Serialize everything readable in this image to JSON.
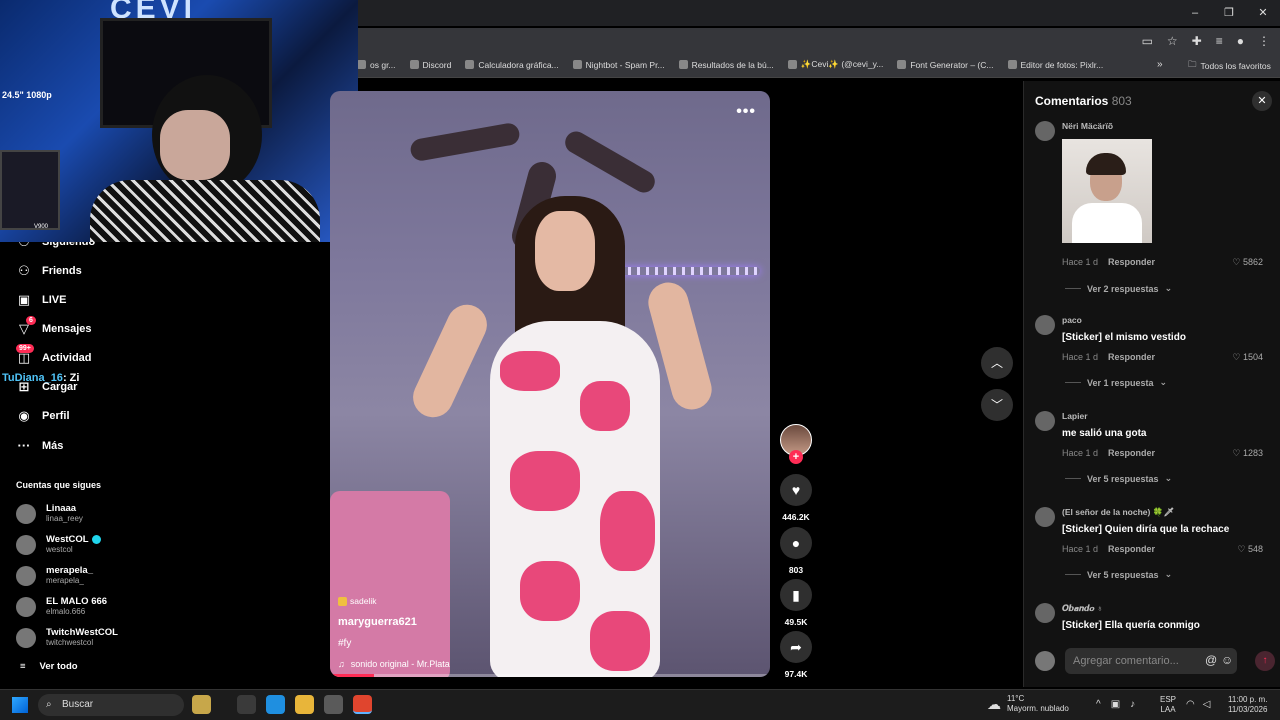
{
  "window": {
    "minimize": "–",
    "maximize": "❐",
    "close": "✕"
  },
  "bookmarks": {
    "items": [
      {
        "label": "os gr...",
        "icon": "page-icon"
      },
      {
        "label": "Discord",
        "icon": "discord-icon"
      },
      {
        "label": "Calculadora gráfica...",
        "icon": "desmos-icon"
      },
      {
        "label": "Nightbot - Spam Pr...",
        "icon": "nightbot-icon"
      },
      {
        "label": "Resultados de la bú...",
        "icon": "doc-icon"
      },
      {
        "label": "✨Cevi✨ (@cevi_y...",
        "icon": "tiktok-icon"
      },
      {
        "label": "Font Generator – (C...",
        "icon": "font-icon"
      },
      {
        "label": "Editor de fotos: Pixlr...",
        "icon": "pixlr-icon"
      }
    ],
    "more": "»",
    "all_favorites": "Todos los favoritos"
  },
  "webcam": {
    "overlay_text": "24.5\" 1080p",
    "logo": "CEVI",
    "pc_label": "V900"
  },
  "nav": {
    "items": [
      {
        "label": "Friends",
        "icon": "friends-icon"
      },
      {
        "label": "LIVE",
        "icon": "live-icon"
      },
      {
        "label": "Mensajes",
        "icon": "messages-icon",
        "badge": "6"
      },
      {
        "label": "Actividad",
        "icon": "activity-icon",
        "badge": "99+"
      },
      {
        "label": "Cargar",
        "icon": "upload-icon"
      },
      {
        "label": "Perfil",
        "icon": "profile-icon"
      },
      {
        "label": "Más",
        "icon": "more-icon"
      }
    ],
    "partial_item": "Siguiendo"
  },
  "chat_overlay": {
    "user": "TuDiana_16",
    "message": ": Zi"
  },
  "following": {
    "title": "Cuentas que sigues",
    "accounts": [
      {
        "name": "Linaaa",
        "handle": "linaa_reey",
        "verified": false
      },
      {
        "name": "WestCOL",
        "handle": "westcol",
        "verified": true
      },
      {
        "name": "merapela_",
        "handle": "merapela_",
        "verified": false
      },
      {
        "name": "EL MALO 666",
        "handle": "elmalo.666",
        "verified": false
      },
      {
        "name": "TwitchWestCOL",
        "handle": "twitchwestcol",
        "verified": false
      }
    ],
    "see_all": "Ver todo"
  },
  "video": {
    "menu": "•••",
    "effect": "sadelik",
    "author": "maryguerra621",
    "caption": "#fy",
    "sound": "sonido original - Mr.Plata",
    "progress": 0.1
  },
  "actions": {
    "follow": "+",
    "likes": "446.2K",
    "comments": "803",
    "saves": "49.5K",
    "shares": "97.4K"
  },
  "comments": {
    "title": "Comentarios",
    "count": "803",
    "list": [
      {
        "user": "Nëri Mäcärïõ",
        "text": "",
        "time": "Hace 1 d",
        "reply": "Responder",
        "likes": "5862",
        "replies": "Ver 2 respuestas",
        "has_image": true
      },
      {
        "user": "paco",
        "text": "[Sticker] el mismo vestido",
        "time": "Hace 1 d",
        "reply": "Responder",
        "likes": "1504",
        "replies": "Ver 1 respuesta",
        "has_image": false
      },
      {
        "user": "Lapier",
        "text": "me salió una gota",
        "time": "Hace 1 d",
        "reply": "Responder",
        "likes": "1283",
        "replies": "Ver 5 respuestas",
        "has_image": false
      },
      {
        "user": "(El señor de la noche) 🍀🗡",
        "text": "[Sticker] Quien diría que la rechace",
        "time": "Hace 1 d",
        "reply": "Responder",
        "likes": "548",
        "replies": "Ver 5 respuestas",
        "has_image": false
      },
      {
        "user": "𝑶𝒃𝒂𝒏𝒅𝒐 ♁",
        "text": "[Sticker] Ella quería conmigo",
        "time": "",
        "reply": "",
        "likes": "",
        "replies": "",
        "has_image": false
      }
    ],
    "input_placeholder": "Agregar comentario..."
  },
  "taskbar": {
    "search": "Buscar",
    "weather_temp": "11°C",
    "weather_desc": "Mayorm. nublado",
    "lang_top": "ESP",
    "lang_bottom": "LAA",
    "time": "11:00 p. m.",
    "date": "11/03/2026"
  }
}
